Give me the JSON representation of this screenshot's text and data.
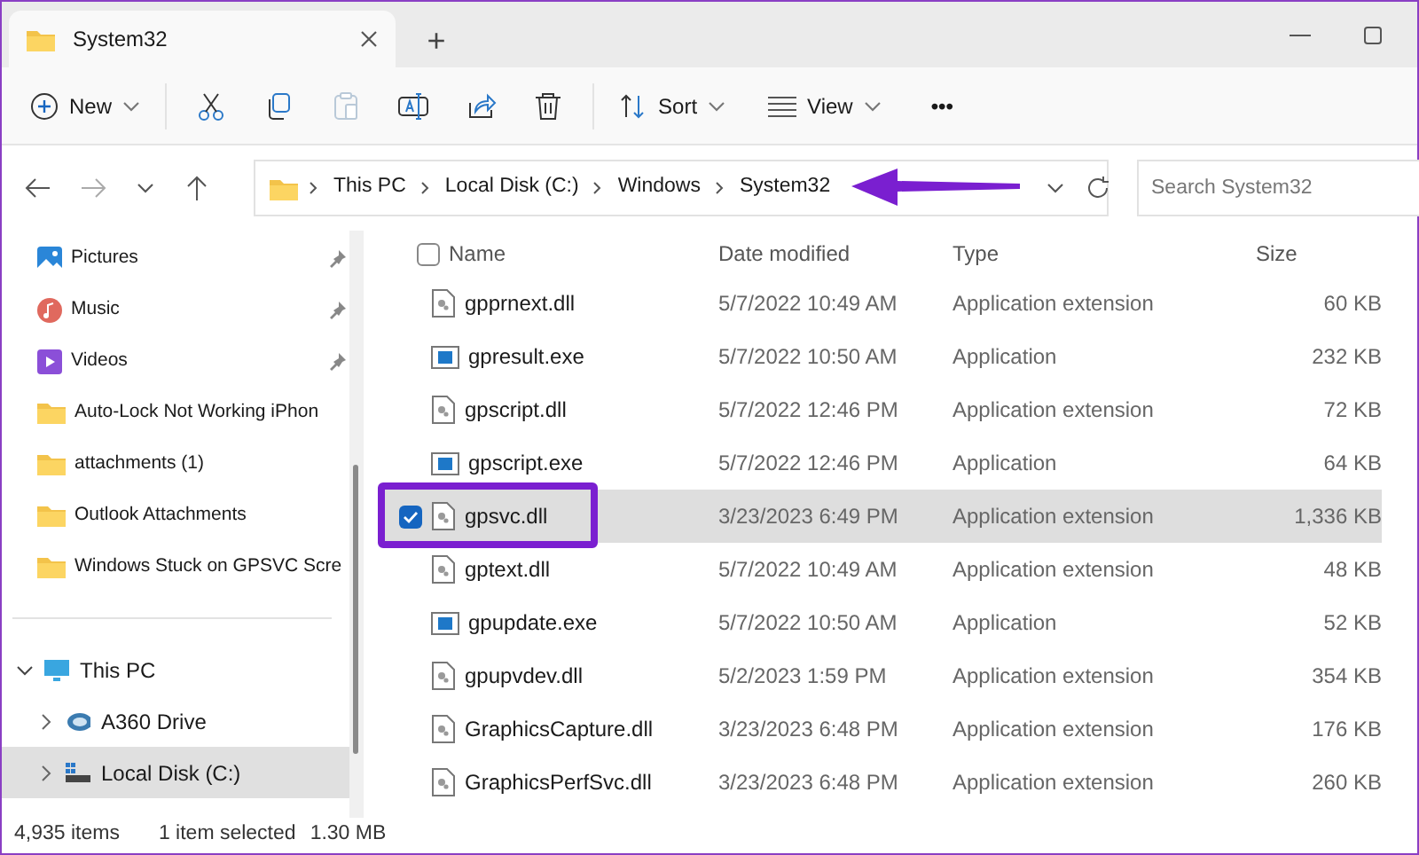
{
  "window": {
    "tab_title": "System32",
    "new_tab": "+"
  },
  "toolbar": {
    "new": "New",
    "sort": "Sort",
    "view": "View",
    "more": "•••",
    "paste_disabled": true
  },
  "navigation": {
    "forward_disabled": true
  },
  "address_bar": {
    "crumbs": [
      "This PC",
      "Local Disk (C:)",
      "Windows",
      "System32"
    ]
  },
  "search": {
    "placeholder": "Search System32"
  },
  "sidebar": {
    "items": [
      {
        "label": "Pictures",
        "kind": "pictures",
        "pinned": true
      },
      {
        "label": "Music",
        "kind": "music",
        "pinned": true
      },
      {
        "label": "Videos",
        "kind": "videos",
        "pinned": true
      },
      {
        "label": "Auto-Lock Not Working iPhon",
        "kind": "folder",
        "pinned": false
      },
      {
        "label": "attachments (1)",
        "kind": "folder",
        "pinned": false
      },
      {
        "label": "Outlook Attachments",
        "kind": "folder",
        "pinned": false
      },
      {
        "label": "Windows Stuck on GPSVC Scre",
        "kind": "folder",
        "pinned": false
      }
    ],
    "tree": [
      {
        "label": "This PC",
        "kind": "pc",
        "expanded": true,
        "selected": false,
        "children": [
          {
            "label": "A360 Drive",
            "kind": "cloud",
            "expanded": false,
            "selected": false
          },
          {
            "label": "Local Disk (C:)",
            "kind": "disk",
            "expanded": false,
            "selected": true
          }
        ]
      }
    ]
  },
  "table": {
    "columns": [
      "Name",
      "Date modified",
      "Type",
      "Size"
    ],
    "all_checked": false,
    "rows": [
      {
        "name": "gpprnext.dll",
        "kind": "dll",
        "date": "5/7/2022 10:49 AM",
        "type": "Application extension",
        "size": "60 KB",
        "selected": false
      },
      {
        "name": "gpresult.exe",
        "kind": "exe",
        "date": "5/7/2022 10:50 AM",
        "type": "Application",
        "size": "232 KB",
        "selected": false
      },
      {
        "name": "gpscript.dll",
        "kind": "dll",
        "date": "5/7/2022 12:46 PM",
        "type": "Application extension",
        "size": "72 KB",
        "selected": false
      },
      {
        "name": "gpscript.exe",
        "kind": "exe",
        "date": "5/7/2022 12:46 PM",
        "type": "Application",
        "size": "64 KB",
        "selected": false
      },
      {
        "name": "gpsvc.dll",
        "kind": "dll",
        "date": "3/23/2023 6:49 PM",
        "type": "Application extension",
        "size": "1,336 KB",
        "selected": true
      },
      {
        "name": "gptext.dll",
        "kind": "dll",
        "date": "5/7/2022 10:49 AM",
        "type": "Application extension",
        "size": "48 KB",
        "selected": false
      },
      {
        "name": "gpupdate.exe",
        "kind": "exe",
        "date": "5/7/2022 10:50 AM",
        "type": "Application",
        "size": "52 KB",
        "selected": false
      },
      {
        "name": "gpupvdev.dll",
        "kind": "dll",
        "date": "5/2/2023 1:59 PM",
        "type": "Application extension",
        "size": "354 KB",
        "selected": false
      },
      {
        "name": "GraphicsCapture.dll",
        "kind": "dll",
        "date": "3/23/2023 6:48 PM",
        "type": "Application extension",
        "size": "176 KB",
        "selected": false
      },
      {
        "name": "GraphicsPerfSvc.dll",
        "kind": "dll",
        "date": "3/23/2023 6:48 PM",
        "type": "Application extension",
        "size": "260 KB",
        "selected": false
      }
    ]
  },
  "status_bar": {
    "items": "4,935 items",
    "selection": "1 item selected",
    "size": "1.30 MB"
  }
}
